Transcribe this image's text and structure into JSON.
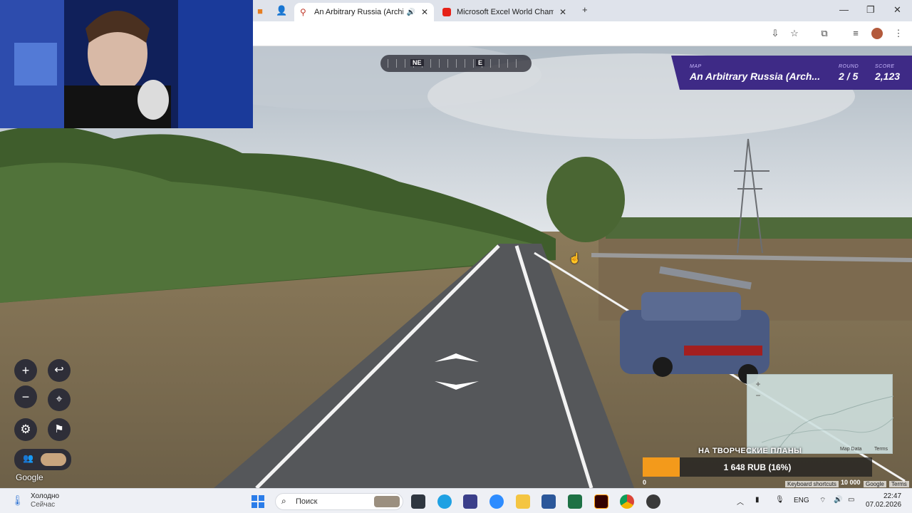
{
  "browser": {
    "tabs": [
      {
        "title": "An Arbitrary Russia (Archive",
        "active": true
      },
      {
        "title": "Microsoft Excel World Champic",
        "active": false
      }
    ],
    "new_tab": "+",
    "window": {
      "minimize": "—",
      "maximize": "❐",
      "close": "✕"
    }
  },
  "compass": {
    "labels": [
      "NE",
      "E"
    ]
  },
  "score_panel": {
    "map_label": "MAP",
    "map_name": "An Arbitrary Russia (Arch...",
    "round_label": "ROUND",
    "round_value": "2 / 5",
    "score_label": "SCORE",
    "score_value": "2,123"
  },
  "controls": {
    "zoom_in": "+",
    "zoom_out": "−",
    "undo": "↩",
    "checkpoint": "⌖",
    "settings": "⚙",
    "flag": "⚑"
  },
  "google_logo": "Google",
  "minimap": {
    "zoom_in": "+",
    "zoom_out": "−",
    "map_data": "Map Data",
    "terms": "Terms",
    "shortcuts": "Keyboard shortcuts",
    "google": "Google",
    "terms2": "Terms"
  },
  "donation": {
    "title": "НА ТВОРЧЕСКИЕ ПЛАНЫ",
    "progress_text": "1 648 RUB (16%)",
    "progress_fraction": 0.16,
    "min": "0",
    "max": "10 000"
  },
  "taskbar": {
    "weather_title": "Холодно",
    "weather_sub": "Сейчас",
    "search": "Поиск",
    "lang": "ENG",
    "time": "22:47",
    "date": "07.02.2026"
  },
  "colors": {
    "score_panel": "#3e2a86",
    "donation_fill": "#f39a1b"
  }
}
